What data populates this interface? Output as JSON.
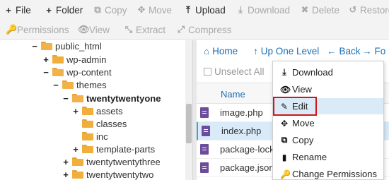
{
  "toolbar": {
    "row1": [
      {
        "label": "File",
        "icon": "+",
        "enabled": true
      },
      {
        "label": "Folder",
        "icon": "+",
        "enabled": true
      },
      {
        "label": "Copy",
        "icon": "⧉",
        "enabled": false
      },
      {
        "label": "Move",
        "icon": "✥",
        "enabled": false
      },
      {
        "label": "Upload",
        "icon": "⤒",
        "enabled": true
      },
      {
        "label": "Download",
        "icon": "⤓",
        "enabled": false
      },
      {
        "label": "Delete",
        "icon": "✖",
        "enabled": false
      },
      {
        "label": "Restore",
        "icon": "↺",
        "enabled": false
      }
    ],
    "row2": [
      {
        "label": "Permissions",
        "icon": "🔑",
        "enabled": false
      },
      {
        "label": "View",
        "icon": "👁",
        "enabled": false
      },
      {
        "label": "Extract",
        "icon": "⤡",
        "enabled": false
      },
      {
        "label": "Compress",
        "icon": "⤢",
        "enabled": false
      }
    ]
  },
  "tree": {
    "items": [
      {
        "label": "public_html",
        "toggle": "−",
        "bold": false,
        "open": true
      },
      {
        "label": "wp-admin",
        "toggle": "+",
        "bold": false,
        "open": false
      },
      {
        "label": "wp-content",
        "toggle": "−",
        "bold": false,
        "open": true
      },
      {
        "label": "themes",
        "toggle": "−",
        "bold": false,
        "open": true
      },
      {
        "label": "twentytwentyone",
        "toggle": "−",
        "bold": true,
        "open": true
      },
      {
        "label": "assets",
        "toggle": "+",
        "bold": false,
        "open": false
      },
      {
        "label": "classes",
        "toggle": "",
        "bold": false,
        "open": false
      },
      {
        "label": "inc",
        "toggle": "",
        "bold": false,
        "open": false
      },
      {
        "label": "template-parts",
        "toggle": "+",
        "bold": false,
        "open": false
      },
      {
        "label": "twentytwentythree",
        "toggle": "+",
        "bold": false,
        "open": false
      },
      {
        "label": "twentytwentytwo",
        "toggle": "+",
        "bold": false,
        "open": false
      }
    ]
  },
  "nav": {
    "home": "Home",
    "up": "Up One Level",
    "back": "Back",
    "forward": "Fo"
  },
  "select": {
    "unselect_all": "Unselect All"
  },
  "table": {
    "header_name": "Name",
    "files": [
      "image.php",
      "index.php",
      "package-lock.json",
      "package.json"
    ]
  },
  "context_menu": {
    "items": [
      {
        "label": "Download",
        "icon": "⤓"
      },
      {
        "label": "View",
        "icon": "👁"
      },
      {
        "label": "Edit",
        "icon": "✎"
      },
      {
        "label": "Move",
        "icon": "✥"
      },
      {
        "label": "Copy",
        "icon": "⧉"
      },
      {
        "label": "Rename",
        "icon": "▮"
      },
      {
        "label": "Change Permissions",
        "icon": "🔑"
      }
    ]
  }
}
